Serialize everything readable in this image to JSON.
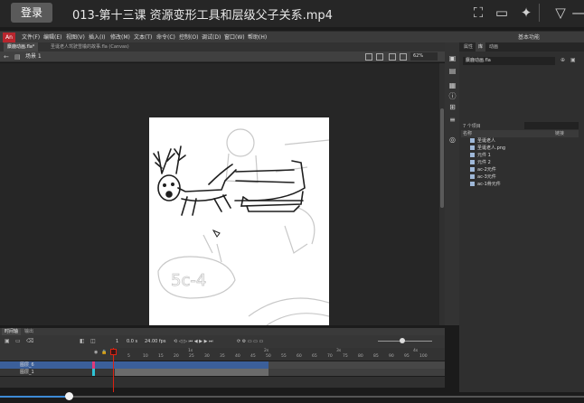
{
  "player": {
    "login_label": "登录",
    "video_title": "013-第十三课 资源变形工具和层级父子关系.mp4",
    "icons": [
      "screenshot-icon",
      "folder-icon",
      "pin-icon",
      "filter-icon"
    ],
    "progress_fraction": 0.12
  },
  "app": {
    "logo": "An",
    "menus": [
      "文件(F)",
      "编辑(E)",
      "视图(V)",
      "插入(I)",
      "修改(M)",
      "文本(T)",
      "命令(C)",
      "控制(O)",
      "调试(D)",
      "窗口(W)",
      "帮助(H)"
    ],
    "workspace": "基本功能"
  },
  "doc_tabs": [
    "麋鹿动画.fla*",
    "圣诞老人驾驶雪橇的故事.fla (Canvas)"
  ],
  "editbar": {
    "scene": "场景 1",
    "zoom": "62%"
  },
  "panel": {
    "tabs": [
      "属性",
      "库",
      "动画"
    ],
    "document": "麋鹿动画.fla",
    "item_count": "7 个项目",
    "column_name": "名称",
    "column_link": "链接",
    "items": [
      "圣诞老人",
      "圣诞老人.png",
      "元件 1",
      "元件 2",
      "ac-2元件",
      "ac-3元件",
      "ac-1骨元件"
    ]
  },
  "timeline": {
    "tabs": [
      "时间轴",
      "输出"
    ],
    "fps": "24.00 fps",
    "frame": "1",
    "time": "0.0 s",
    "layers": [
      "图层_6",
      "图层_1"
    ],
    "ruler_seconds": [
      "1s",
      "2s",
      "3s",
      "4s"
    ],
    "ruler_frames": [
      "5",
      "10",
      "15",
      "20",
      "25",
      "30",
      "35",
      "40",
      "45",
      "50",
      "55",
      "60",
      "65",
      "70",
      "75",
      "80",
      "85",
      "90",
      "95",
      "100"
    ]
  }
}
